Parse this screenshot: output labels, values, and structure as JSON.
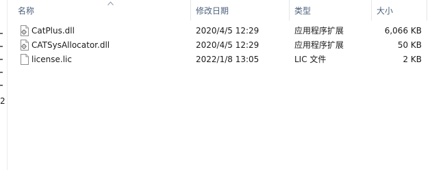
{
  "columns": {
    "name": "名称",
    "date": "修改日期",
    "type": "类型",
    "size": "大小"
  },
  "nav_partial_text": "2",
  "files": [
    {
      "name": "CatPlus.dll",
      "date": "2020/4/5 12:29",
      "type": "应用程序扩展",
      "size": "6,066 KB",
      "icon": "dll-file-icon"
    },
    {
      "name": "CATSysAllocator.dll",
      "date": "2020/4/5 12:29",
      "type": "应用程序扩展",
      "size": "50 KB",
      "icon": "dll-file-icon"
    },
    {
      "name": "license.lic",
      "date": "2022/1/8 13:05",
      "type": "LIC 文件",
      "size": "2 KB",
      "icon": "blank-file-icon"
    }
  ],
  "colors": {
    "header_text": "#4c607a",
    "row_text": "#1a1a1a"
  }
}
